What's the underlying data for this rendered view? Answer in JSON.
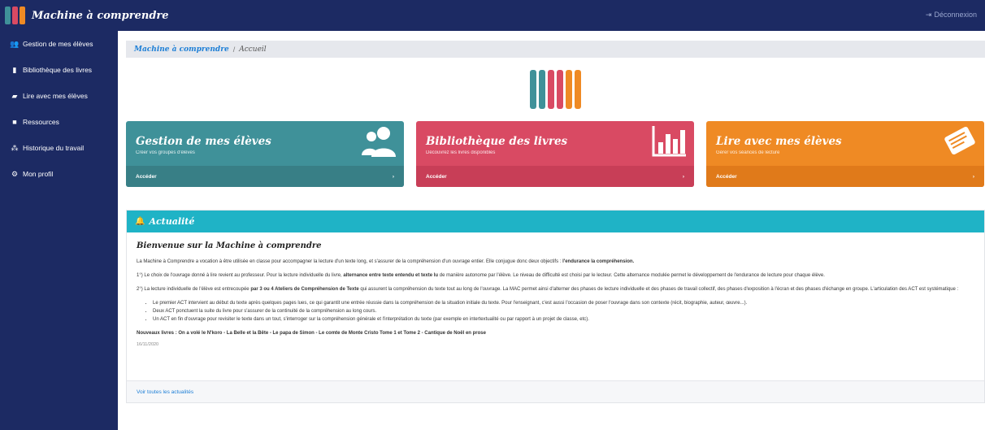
{
  "app": {
    "title": "Machine à comprendre",
    "logout_label": "Déconnexion",
    "logo_colors": [
      "#3f9199",
      "#d94a63",
      "#ef8a24"
    ]
  },
  "sidebar": {
    "items": [
      {
        "label": "Gestion de mes élèves",
        "icon": "users-icon"
      },
      {
        "label": "Bibliothèque des livres",
        "icon": "bar-chart-icon"
      },
      {
        "label": "Lire avec mes élèves",
        "icon": "book-icon"
      },
      {
        "label": "Ressources",
        "icon": "folder-icon"
      },
      {
        "label": "Historique du travail",
        "icon": "sitemap-icon"
      },
      {
        "label": "Mon profil",
        "icon": "gear-icon"
      }
    ]
  },
  "breadcrumb": {
    "root": "Machine à comprendre",
    "separator": "/",
    "current": "Accueil"
  },
  "cards": [
    {
      "title": "Gestion de mes élèves",
      "subtitle": "Créer vos groupes d'élèves",
      "action": "Accéder",
      "arrow": "›",
      "icon": "users-icon",
      "color": "#3f9199"
    },
    {
      "title": "Bibliothèque des livres",
      "subtitle": "Découvrez les livres disponibles",
      "action": "Accéder",
      "arrow": "›",
      "icon": "bar-chart-icon",
      "color": "#d94a63"
    },
    {
      "title": "Lire avec mes élèves",
      "subtitle": "Gérer vos séances de lecture",
      "action": "Accéder",
      "arrow": "›",
      "icon": "book-icon",
      "color": "#ef8a24"
    }
  ],
  "news": {
    "header": "Actualité",
    "title": "Bienvenue sur la Machine à comprendre",
    "p1_text": "La Machine à Comprendre a vocation à être utilisée en classe pour accompagner la lecture d'un texte long, et s'assurer de la compréhension d'un ouvrage entier. Elle conjugue donc deux objectifs : ",
    "p1_bold": "l'endurance la compréhension.",
    "p2_a": "1°) Le choix de l'ouvrage donné à lire revient au professeur. Pour la lecture individuelle du livre, ",
    "p2_bold": "alternance entre texte entendu et texte lu",
    "p2_b": " de manière autonome par l'élève. Le niveau de difficulté est choisi par le lecteur. Cette alternance modulée permet le développement de l'endurance de lecture pour chaque élève.",
    "p3_a": "2°) La lecture individuelle de l'élève est entrecoupée ",
    "p3_bold": "par 3 ou 4 Ateliers de Compréhension de Texte",
    "p3_b": " qui assurent la compréhension du texte tout au long de l'ouvrage. La MAC permet ainsi d'alterner des phases de lecture individuelle et des phases de travail collectif, des phases d'exposition à l'écran et des phases d'échange en groupe. L'articulation des ACT est systématique :",
    "bullets": [
      "Le premier ACT intervient au début du texte après quelques pages lues, ce qui garantit une entrée réussie dans la compréhension de la situation initiale du texte. Pour l'enseignant, c'est aussi l'occasion de poser l'ouvrage dans son contexte (récit, biographie, auteur, œuvre...).",
      "Deux ACT ponctuent la suite du livre pour s'assurer de la continuité de la compréhension au long cours.",
      "Un ACT en fin d'ouvrage pour revisiter le texte dans un tout, s'interroger sur la compréhension générale et l'interprétation du texte (par exemple en intertextualité ou par rapport à un projet de classe, etc)."
    ],
    "new_books": "Nouveaux livres : On a volé le N'koro - La Belle et la Bête - Le papa de Simon - Le comte de Monte Cristo Tome 1 et Tome 2 - Cantique de Noël en prose",
    "date": "16/11/2020",
    "footer_link": "Voir toutes les actualités"
  }
}
